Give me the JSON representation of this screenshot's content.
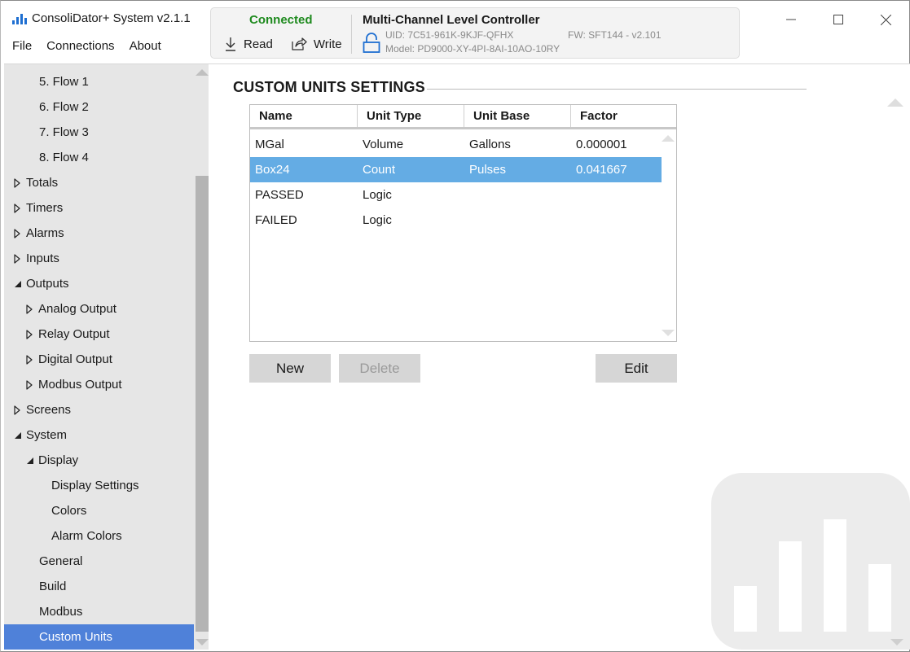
{
  "window": {
    "title": "ConsoliDator+ System v2.1.1",
    "app_icon": "bar-chart-icon",
    "menu": [
      "File",
      "Connections",
      "About"
    ],
    "controls": {
      "minimize": "minimize-icon",
      "maximize": "maximize-icon",
      "close": "close-icon"
    }
  },
  "device": {
    "status": "Connected",
    "status_color": "#1e8a1e",
    "read_label": "Read",
    "write_label": "Write",
    "name": "Multi-Channel Level Controller",
    "uid": "UID: 7C51-961K-9KJF-QFHX",
    "fw": "FW: SFT144 - v2.101",
    "model": "Model: PD9000-XY-4PI-8AI-10AO-10RY",
    "lock_state": "unlocked"
  },
  "sidebar": {
    "selected_color": "#4f81d9",
    "items": [
      {
        "label": "5. Flow 1",
        "level": "lvl1 leaf",
        "arrow": ""
      },
      {
        "label": "6. Flow 2",
        "level": "lvl1 leaf",
        "arrow": ""
      },
      {
        "label": "7. Flow 3",
        "level": "lvl1 leaf",
        "arrow": ""
      },
      {
        "label": "8. Flow 4",
        "level": "lvl1 leaf",
        "arrow": ""
      },
      {
        "label": "Totals",
        "level": "lvl0",
        "arrow": "collapsed"
      },
      {
        "label": "Timers",
        "level": "lvl0",
        "arrow": "collapsed"
      },
      {
        "label": "Alarms",
        "level": "lvl0",
        "arrow": "collapsed"
      },
      {
        "label": "Inputs",
        "level": "lvl0",
        "arrow": "collapsed"
      },
      {
        "label": "Outputs",
        "level": "lvl0",
        "arrow": "expanded"
      },
      {
        "label": "Analog Output",
        "level": "lvl1",
        "arrow": "collapsed"
      },
      {
        "label": "Relay Output",
        "level": "lvl1",
        "arrow": "collapsed"
      },
      {
        "label": "Digital Output",
        "level": "lvl1",
        "arrow": "collapsed"
      },
      {
        "label": "Modbus Output",
        "level": "lvl1",
        "arrow": "collapsed"
      },
      {
        "label": "Screens",
        "level": "lvl0",
        "arrow": "collapsed"
      },
      {
        "label": "System",
        "level": "lvl0",
        "arrow": "expanded"
      },
      {
        "label": "Display",
        "level": "lvl1",
        "arrow": "expanded"
      },
      {
        "label": "Display Settings",
        "level": "lvl2",
        "arrow": ""
      },
      {
        "label": "Colors",
        "level": "lvl2",
        "arrow": ""
      },
      {
        "label": "Alarm Colors",
        "level": "lvl2",
        "arrow": ""
      },
      {
        "label": "General",
        "level": "lvl1 leaf",
        "arrow": ""
      },
      {
        "label": "Build",
        "level": "lvl1 leaf",
        "arrow": ""
      },
      {
        "label": "Modbus",
        "level": "lvl1 leaf",
        "arrow": ""
      },
      {
        "label": "Custom Units",
        "level": "lvl1 leaf",
        "arrow": "",
        "selected": true
      }
    ]
  },
  "main": {
    "section_title": "CUSTOM UNITS SETTINGS",
    "table": {
      "columns": [
        "Name",
        "Unit Type",
        "Unit Base",
        "Factor"
      ],
      "selected_color": "#64ace4",
      "rows": [
        {
          "name": "MGal",
          "type": "Volume",
          "base": "Gallons",
          "factor": "0.000001"
        },
        {
          "name": "Box24",
          "type": "Count",
          "base": "Pulses",
          "factor": "0.041667",
          "selected": true
        },
        {
          "name": "PASSED",
          "type": "Logic",
          "base": "",
          "factor": ""
        },
        {
          "name": "FAILED",
          "type": "Logic",
          "base": "",
          "factor": ""
        }
      ]
    },
    "buttons": {
      "new": "New",
      "delete": "Delete",
      "edit": "Edit"
    },
    "delete_enabled": false
  }
}
